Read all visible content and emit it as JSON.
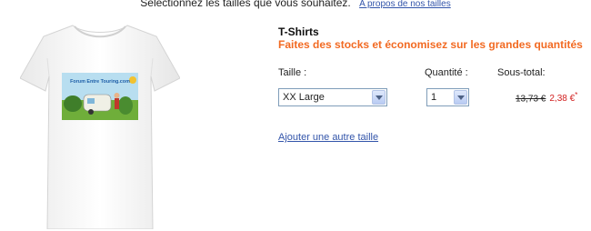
{
  "instruction": {
    "text": "Sélectionnez les tailles que vous souhaitez.",
    "link": "A propos de nos tailles"
  },
  "product": {
    "title": "T-Shirts",
    "promo": "Faites des stocks et économisez sur les grandes quantités",
    "print_text": "Forum Entre Touring.com",
    "accent_color": "#f26a22"
  },
  "columns": {
    "size": "Taille :",
    "quantity": "Quantité :",
    "subtotal": "Sous-total:"
  },
  "row": {
    "size_value": "XX Large",
    "quantity_value": "1",
    "old_price": "13,73 €",
    "new_price": "2,38 €",
    "price_mark": "*"
  },
  "actions": {
    "add_size": "Ajouter une autre taille"
  }
}
